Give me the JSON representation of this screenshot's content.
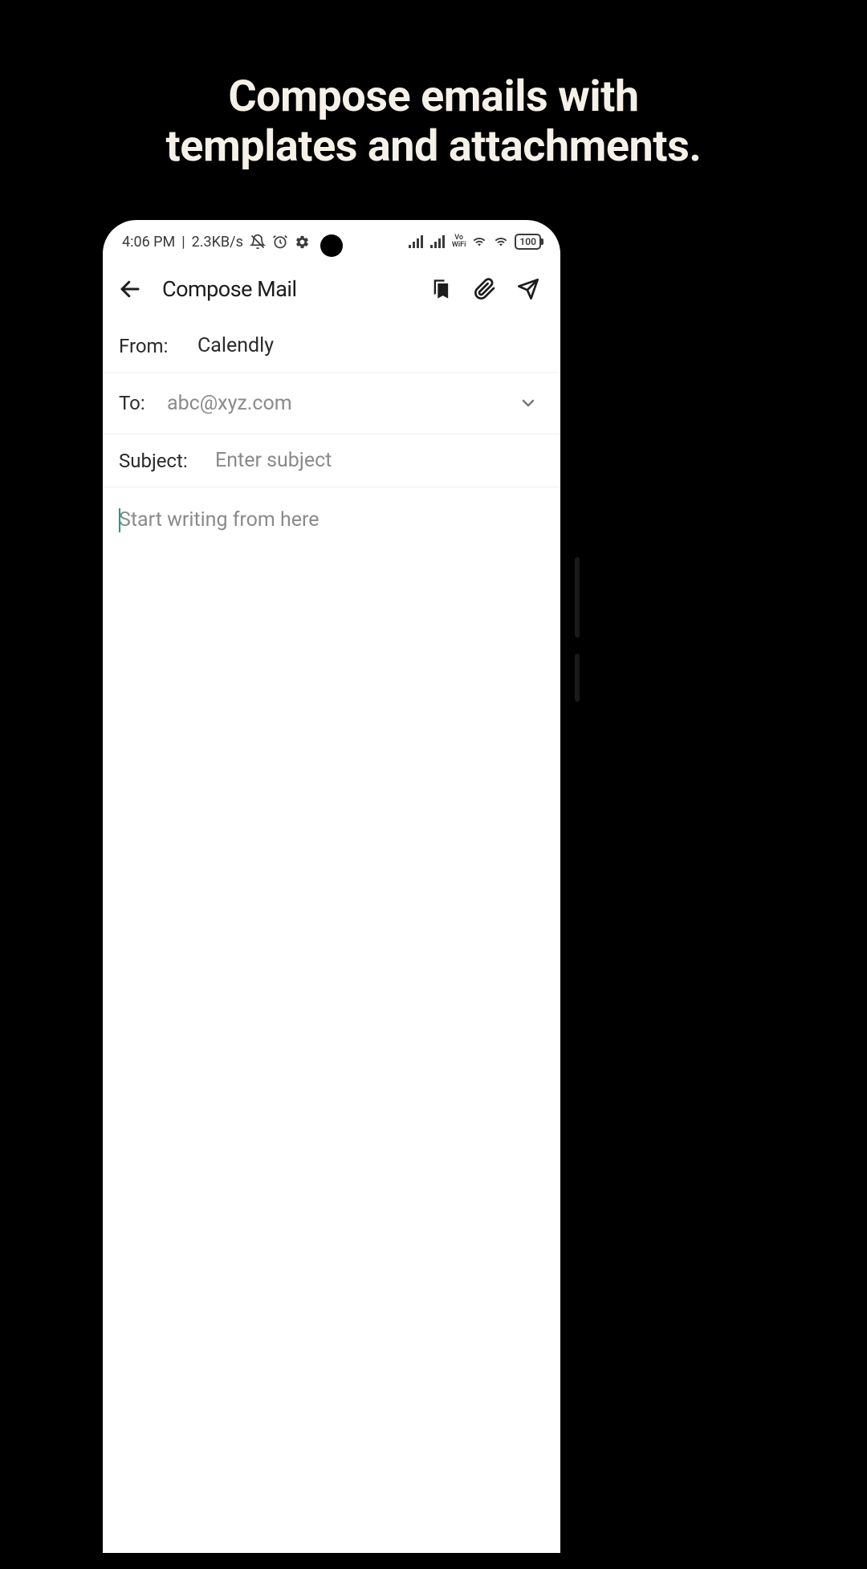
{
  "promo": {
    "headline_line1": "Compose emails with",
    "headline_line2": "templates and attachments."
  },
  "statusbar": {
    "time": "4:06 PM",
    "net_speed": "2.3KB/s",
    "vowifi_top": "Vo",
    "vowifi_bot": "WiFi",
    "battery": "100"
  },
  "appbar": {
    "title": "Compose Mail"
  },
  "fields": {
    "from_label": "From:",
    "from_value": "Calendly",
    "to_label": "To:",
    "to_placeholder": "abc@xyz.com",
    "subject_label": "Subject:",
    "subject_placeholder": "Enter subject"
  },
  "body": {
    "placeholder": "Start writing from here"
  }
}
